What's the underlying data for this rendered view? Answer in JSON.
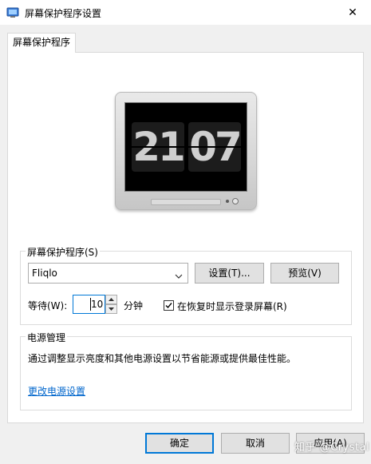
{
  "window": {
    "title": "屏幕保护程序设置",
    "close_label": "✕"
  },
  "tab": {
    "label": "屏幕保护程序"
  },
  "preview": {
    "hour": "21",
    "minute": "07"
  },
  "screensaver_group": {
    "legend": "屏幕保护程序(S)",
    "selected": "Fliqlo",
    "settings_button": "设置(T)...",
    "preview_button": "预览(V)",
    "wait_label": "等待(W):",
    "wait_value": "10",
    "wait_unit": "分钟",
    "resume_checkbox_checked": true,
    "resume_label": "在恢复时显示登录屏幕(R)"
  },
  "power_group": {
    "legend": "电源管理",
    "description": "通过调整显示亮度和其他电源设置以节省能源或提供最佳性能。",
    "link": "更改电源设置"
  },
  "footer": {
    "ok": "确定",
    "cancel": "取消",
    "apply": "应用(A)"
  },
  "watermark": "知乎 @Crystal",
  "colors": {
    "accent": "#0078d7",
    "link": "#0066cc",
    "button_face": "#e1e1e1",
    "window_bg": "#f0f0f0"
  }
}
